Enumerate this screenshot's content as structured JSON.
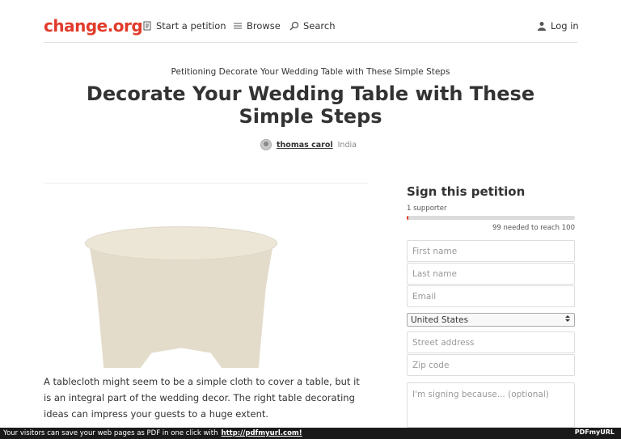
{
  "header": {
    "logo": "change.org",
    "nav": {
      "start_petition": "Start a petition",
      "browse": "Browse",
      "search": "Search",
      "login": "Log in"
    }
  },
  "petition": {
    "petitioning": "Petitioning Decorate Your Wedding Table with These Simple Steps",
    "title": "Decorate Your Wedding Table with These Simple Steps",
    "author_name": "thomas carol",
    "author_location": "India",
    "description": "A tablecloth might seem to be a simple cloth to cover a table, but it is an integral part of the wedding decor. The right table decorating ideas can impress your guests to a huge extent."
  },
  "sign": {
    "title": "Sign this petition",
    "supporters": "1 supporter",
    "progress_fraction": 0.01,
    "needed": "99 needed to reach 100",
    "first_name_placeholder": "First name",
    "last_name_placeholder": "Last name",
    "email_placeholder": "Email",
    "country": "United States",
    "street_placeholder": "Street address",
    "zip_placeholder": "Zip code",
    "reason_placeholder": "I'm signing because... (optional)"
  },
  "footer": {
    "text": "Your visitors can save your web pages as PDF in one click with",
    "link": "http://pdfmyurl.com!",
    "logo": "PDFmyURL"
  },
  "colors": {
    "brand": "#e13b2b",
    "footer_bg": "#1a1a1a"
  },
  "icons": [
    "petition-icon",
    "list-icon",
    "search-icon",
    "user-icon",
    "select-arrows-icon"
  ]
}
